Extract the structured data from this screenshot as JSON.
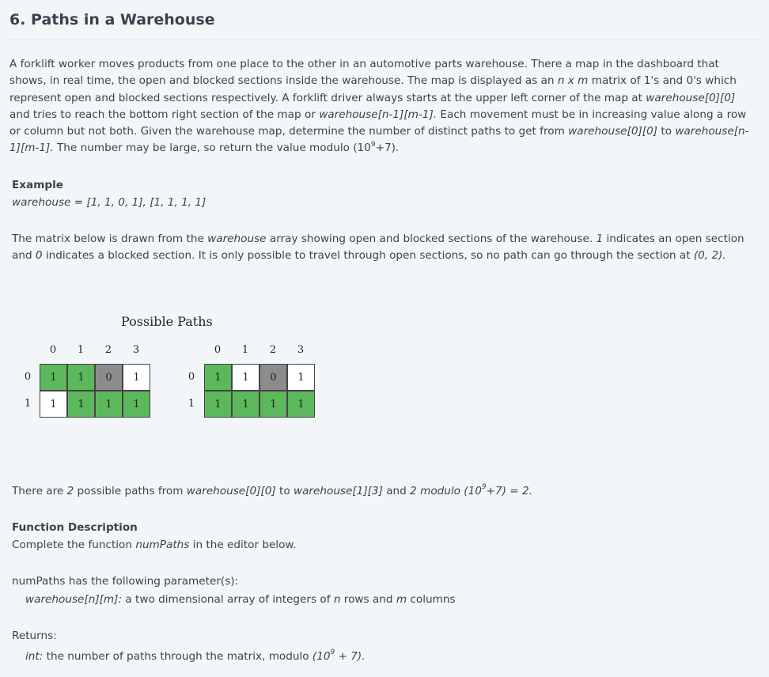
{
  "title": "6. Paths in a Warehouse",
  "intro": {
    "p1": "A forklift worker moves products from one place to the other in an automotive parts warehouse. There a map in the dashboard that shows, in real time, the open and blocked sections inside the warehouse. The map is displayed as an ",
    "nxm": "n x m",
    "p2": " matrix of 1's and 0's which represent open and blocked sections respectively. A forklift driver always starts at the upper left corner of the map at ",
    "start": "warehouse[0][0]",
    "p3": " and tries to reach the bottom right section of the map or ",
    "end": "warehouse[n-1][m-1].",
    "p4": " Each movement must be in increasing value along a row or column but not both.  Given the warehouse map, determine the number of distinct paths to get from ",
    "start2": "warehouse[0][0]",
    "p5": " to ",
    "end2": "warehouse[n-1][m-1].",
    "p6": " The number may be large, so return the value modulo (10",
    "exp": "9",
    "p7": "+7)."
  },
  "example": {
    "heading": "Example",
    "value": "warehouse = [1, 1, 0, 1], [1, 1, 1, 1]"
  },
  "matrix_desc": {
    "a": "The matrix below is drawn from the ",
    "arr": "warehouse",
    "b": " array showing open and blocked sections of the warehouse. ",
    "one": "1",
    "c": " indicates an open section and ",
    "zero": "0",
    "d": " indicates a blocked section. It is only possible to travel through open sections, so no path can go through the section at ",
    "cell": "(0, 2)."
  },
  "figure": {
    "title": "Possible Paths",
    "col_headers": [
      "0",
      "1",
      "2",
      "3"
    ],
    "row_headers": [
      "0",
      "1"
    ],
    "grids": [
      {
        "values": [
          [
            "1",
            "1",
            "0",
            "1"
          ],
          [
            "1",
            "1",
            "1",
            "1"
          ]
        ],
        "colors": [
          [
            "green",
            "green",
            "gray",
            "white"
          ],
          [
            "white",
            "green",
            "green",
            "green"
          ]
        ]
      },
      {
        "values": [
          [
            "1",
            "1",
            "0",
            "1"
          ],
          [
            "1",
            "1",
            "1",
            "1"
          ]
        ],
        "colors": [
          [
            "green",
            "white",
            "gray",
            "white"
          ],
          [
            "green",
            "green",
            "green",
            "green"
          ]
        ]
      }
    ]
  },
  "result": {
    "a": "There are ",
    "n": "2",
    "b": " possible paths from ",
    "from": "warehouse[0][0]",
    "c": " to ",
    "to": "warehouse[1][3]",
    "d": " and ",
    "expr": "2 modulo (10",
    "exp": "9",
    "expr2": "+7) = 2."
  },
  "function_desc": {
    "heading": "Function Description",
    "a": "Complete the function ",
    "fn": "numPaths",
    "b": " in the editor below."
  },
  "params": {
    "line": "numPaths has the following parameter(s):",
    "p_name": "warehouse[n][m]:",
    "p_a": " a two dimensional array of integers of ",
    "p_n": "n",
    "p_b": " rows and ",
    "p_m": "m",
    "p_c": " columns"
  },
  "returns": {
    "heading": "Returns:",
    "type": "int:",
    "a": " the number of paths through the matrix, modulo ",
    "mod1": "(10",
    "exp": "9",
    "mod2": " + 7)."
  }
}
